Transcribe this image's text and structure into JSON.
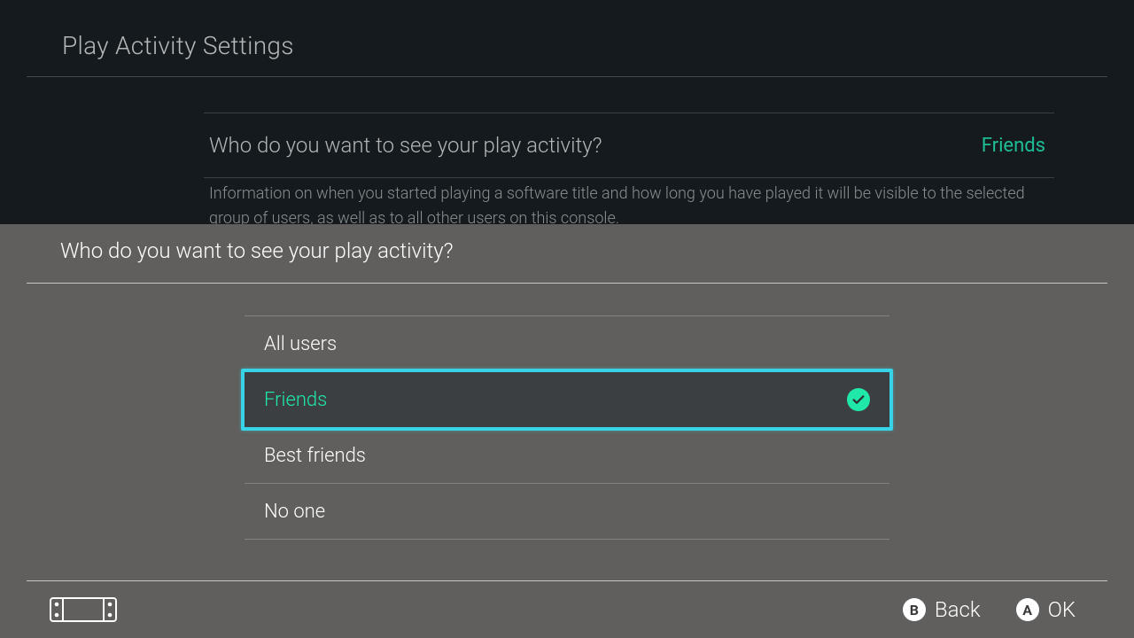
{
  "page": {
    "title": "Play Activity Settings",
    "setting": {
      "label": "Who do you want to see your play activity?",
      "value": "Friends",
      "description": "Information on when you started playing a software title and how long you have played it will be visible to the selected group of users, as well as to all other users on this console."
    }
  },
  "modal": {
    "title": "Who do you want to see your play activity?",
    "options": [
      {
        "label": "All users",
        "selected": false
      },
      {
        "label": "Friends",
        "selected": true
      },
      {
        "label": "Best friends",
        "selected": false
      },
      {
        "label": "No one",
        "selected": false
      }
    ]
  },
  "footer": {
    "back": {
      "glyph": "B",
      "label": "Back"
    },
    "ok": {
      "glyph": "A",
      "label": "OK"
    }
  }
}
